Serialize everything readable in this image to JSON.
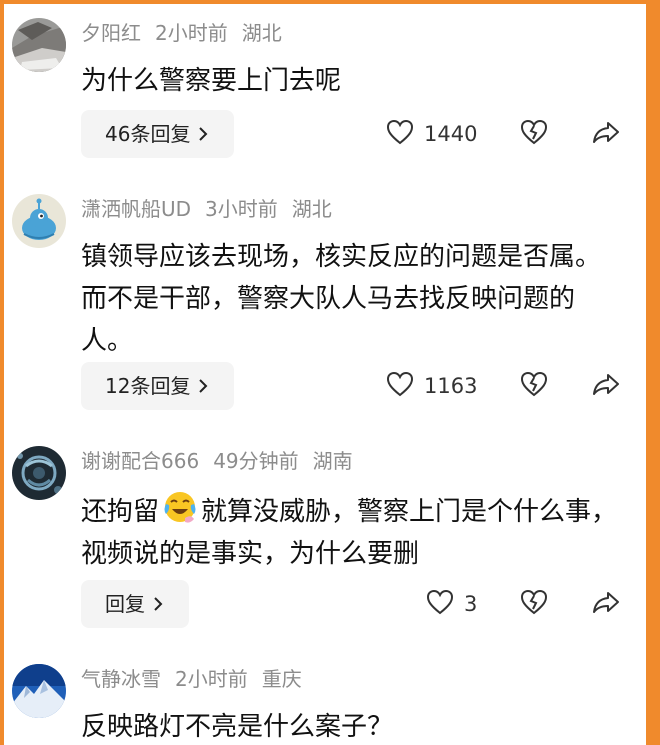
{
  "comments": [
    {
      "author": "夕阳红",
      "time": "2小时前",
      "location": "湖北",
      "text": "为什么警察要上门去呢",
      "reply_label": "46条回复",
      "likes": "1440",
      "avatar": "landscape-avatar"
    },
    {
      "author": "潇洒帆船UD",
      "time": "3小时前",
      "location": "湖北",
      "text": "镇领导应该去现场，核实反应的问题是否属。而不是干部，警察大队人马去找反映问题的人。",
      "reply_label": "12条回复",
      "likes": "1163",
      "avatar": "blue-creature-avatar"
    },
    {
      "author": "谢谢配合666",
      "time": "49分钟前",
      "location": "湖南",
      "text_before": "还拘留",
      "text_after": "就算没威胁，警察上门是个什么事，视频说的是事实，为什么要删",
      "emoji": "crying-laughing-emoji",
      "reply_label": "回复",
      "likes": "3",
      "avatar": "dark-pattern-avatar"
    },
    {
      "author": "气静冰雪",
      "time": "2小时前",
      "location": "重庆",
      "text": "反映路灯不亮是什么案子？",
      "avatar": "snow-mountain-avatar"
    }
  ],
  "icons": {
    "like": "heart-icon",
    "dislike": "broken-heart-icon",
    "share": "share-arrow-icon",
    "chevron": "chevron-right-icon"
  },
  "colors": {
    "border": "#f08a2c",
    "meta_text": "#8c8c8c",
    "button_bg": "#f4f4f4"
  }
}
